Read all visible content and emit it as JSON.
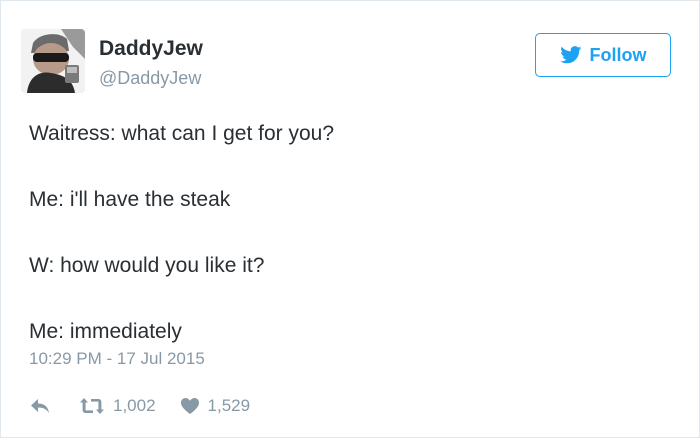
{
  "user": {
    "display_name": "DaddyJew",
    "handle": "@DaddyJew"
  },
  "follow_button": {
    "label": "Follow",
    "icon": "twitter-bird-icon"
  },
  "tweet": {
    "lines": [
      "Waitress: what can I get for you?",
      "Me: i'll have the steak",
      "W: how would you like it?",
      "Me: immediately"
    ],
    "timestamp": "10:29 PM - 17 Jul 2015"
  },
  "actions": {
    "reply_icon": "reply-icon",
    "retweet_icon": "retweet-icon",
    "retweet_count": "1,002",
    "like_icon": "heart-icon",
    "like_count": "1,529"
  },
  "colors": {
    "accent": "#1da1f2",
    "text": "#292f33",
    "muted": "#8899a6",
    "border": "#e1e8ed"
  }
}
